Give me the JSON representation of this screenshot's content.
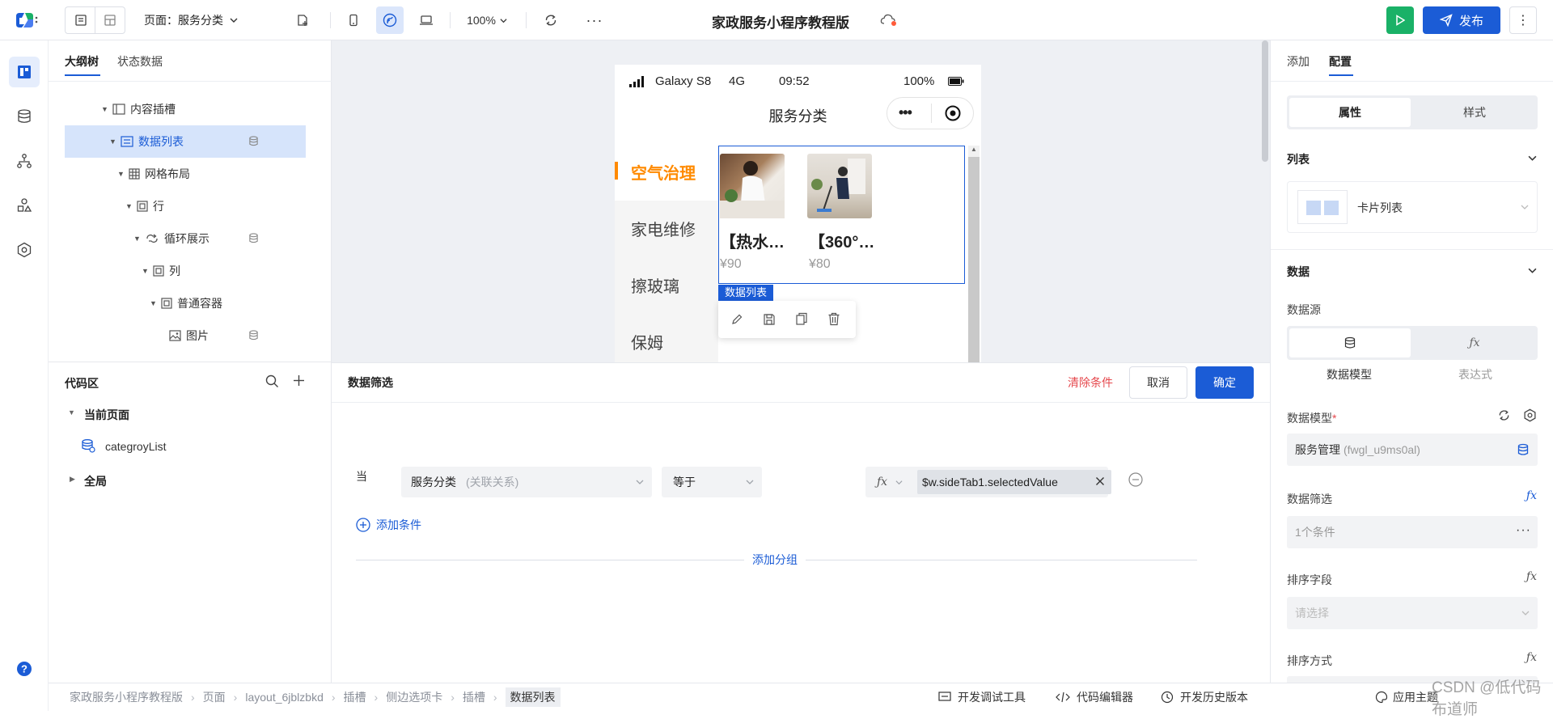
{
  "topbar": {
    "page_selector": "页面：服务分类",
    "zoom": "100%",
    "app_title": "家政服务小程序教程版",
    "publish_label": "发布"
  },
  "outline": {
    "tabs": [
      "大纲树",
      "状态数据"
    ],
    "nodes": [
      {
        "label": "内容插槽"
      },
      {
        "label": "数据列表"
      },
      {
        "label": "网格布局"
      },
      {
        "label": "行"
      },
      {
        "label": "循环展示"
      },
      {
        "label": "列"
      },
      {
        "label": "普通容器"
      },
      {
        "label": "图片"
      }
    ]
  },
  "code": {
    "title": "代码区",
    "current_page": "当前页面",
    "item": "categroyList",
    "global": "全局"
  },
  "phone": {
    "device": "Galaxy S8",
    "network": "4G",
    "time": "09:52",
    "battery": "100%",
    "nav_title": "服务分类",
    "side_tabs": [
      "空气治理",
      "家电维修",
      "擦玻璃",
      "保姆"
    ],
    "cards": [
      {
        "title": "【热水…",
        "price": "¥90"
      },
      {
        "title": "【360°…",
        "price": "¥80"
      }
    ],
    "selected_tag": "数据列表"
  },
  "filter": {
    "title": "数据筛选",
    "clear": "清除条件",
    "cancel": "取消",
    "confirm": "确定",
    "when": "当",
    "field_name": "服务分类",
    "field_hint": "(关联关系)",
    "operator": "等于",
    "value": "$w.sideTab1.selectedValue",
    "add_condition": "添加条件",
    "add_group": "添加分组"
  },
  "right": {
    "tabs": [
      "添加",
      "配置"
    ],
    "seg": [
      "属性",
      "样式"
    ],
    "list_section": "列表",
    "list_type": "卡片列表",
    "data_section": "数据",
    "datasource_label": "数据源",
    "datasource_options": [
      "数据模型",
      "表达式"
    ],
    "model_label": "数据模型",
    "model_name": "服务管理",
    "model_id": "(fwgl_u9ms0al)",
    "filter_label": "数据筛选",
    "filter_value": "1个条件",
    "sort_field_label": "排序字段",
    "sort_field_placeholder": "请选择",
    "sort_order_label": "排序方式"
  },
  "bottombar": {
    "breadcrumb": [
      "家政服务小程序教程版",
      "页面",
      "layout_6jblzbkd",
      "插槽",
      "侧边选项卡",
      "插槽",
      "数据列表"
    ],
    "tools": [
      "开发调试工具",
      "代码编辑器",
      "开发历史版本"
    ],
    "theme": "应用主题",
    "watermark": "CSDN @低代码布道师"
  },
  "colors": {
    "primary": "#1b5cd6",
    "green": "#1ab167",
    "orange": "#ff8a00",
    "danger": "#e5484d",
    "selected_bg": "#d6e4fb"
  }
}
